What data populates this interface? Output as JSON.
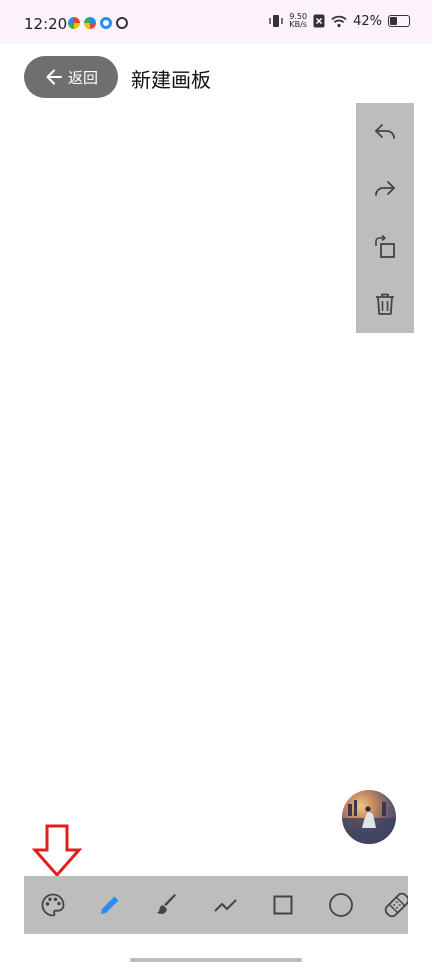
{
  "status_bar": {
    "time": "12:20",
    "network_speed_value": "9.50",
    "network_speed_unit": "KB/s",
    "battery_percent": "42%",
    "battery_level": 0.42
  },
  "header": {
    "back_label": "返回",
    "title": "新建画板"
  },
  "side_tools": [
    {
      "icon": "undo-icon"
    },
    {
      "icon": "redo-icon"
    },
    {
      "icon": "rotate-icon"
    },
    {
      "icon": "trash-icon"
    }
  ],
  "bottom_tools": [
    {
      "icon": "palette-icon"
    },
    {
      "icon": "pencil-icon",
      "active": true
    },
    {
      "icon": "brush-icon"
    },
    {
      "icon": "polyline-icon"
    },
    {
      "icon": "rectangle-icon"
    },
    {
      "icon": "circle-icon"
    },
    {
      "icon": "eraser-icon"
    }
  ],
  "colors": {
    "accent": "#2a8cf0",
    "toolbar_bg": "#bdbdbd",
    "back_button_bg": "#6f6f6f",
    "annotation_red": "#e0201f",
    "status_bar_bg": "#fbf2fb"
  }
}
